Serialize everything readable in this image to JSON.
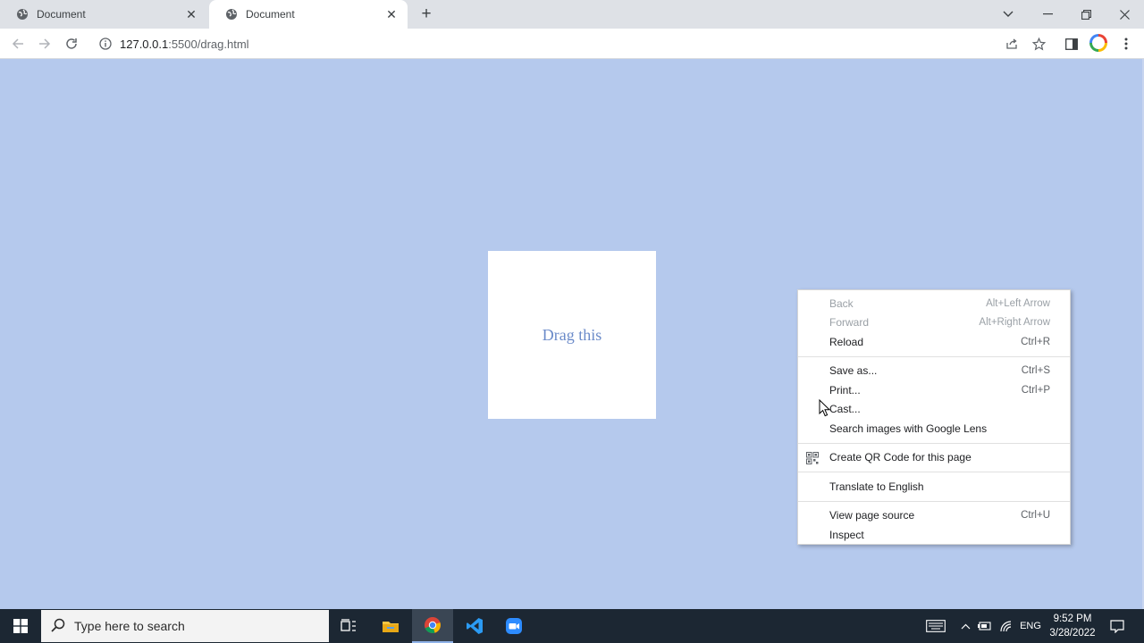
{
  "browser": {
    "tabs": [
      {
        "title": "Document",
        "active": false
      },
      {
        "title": "Document",
        "active": true
      }
    ],
    "url_host": "127.0.0.1",
    "url_rest": ":5500/drag.html"
  },
  "page": {
    "background": "#b5c9ed",
    "drag_box_label": "Drag this"
  },
  "context_menu": {
    "groups": [
      [
        {
          "label": "Back",
          "shortcut": "Alt+Left Arrow",
          "disabled": true
        },
        {
          "label": "Forward",
          "shortcut": "Alt+Right Arrow",
          "disabled": true
        },
        {
          "label": "Reload",
          "shortcut": "Ctrl+R",
          "disabled": false
        }
      ],
      [
        {
          "label": "Save as...",
          "shortcut": "Ctrl+S",
          "disabled": false
        },
        {
          "label": "Print...",
          "shortcut": "Ctrl+P",
          "disabled": false
        },
        {
          "label": "Cast...",
          "shortcut": "",
          "disabled": false
        },
        {
          "label": "Search images with Google Lens",
          "shortcut": "",
          "disabled": false
        }
      ],
      [
        {
          "label": "Create QR Code for this page",
          "shortcut": "",
          "disabled": false,
          "icon": "qr-code-icon"
        }
      ],
      [
        {
          "label": "Translate to English",
          "shortcut": "",
          "disabled": false
        }
      ],
      [
        {
          "label": "View page source",
          "shortcut": "Ctrl+U",
          "disabled": false
        },
        {
          "label": "Inspect",
          "shortcut": "",
          "disabled": false
        }
      ]
    ]
  },
  "taskbar": {
    "search_placeholder": "Type here to search",
    "language": "ENG",
    "time": "9:52 PM",
    "date": "3/28/2022"
  }
}
